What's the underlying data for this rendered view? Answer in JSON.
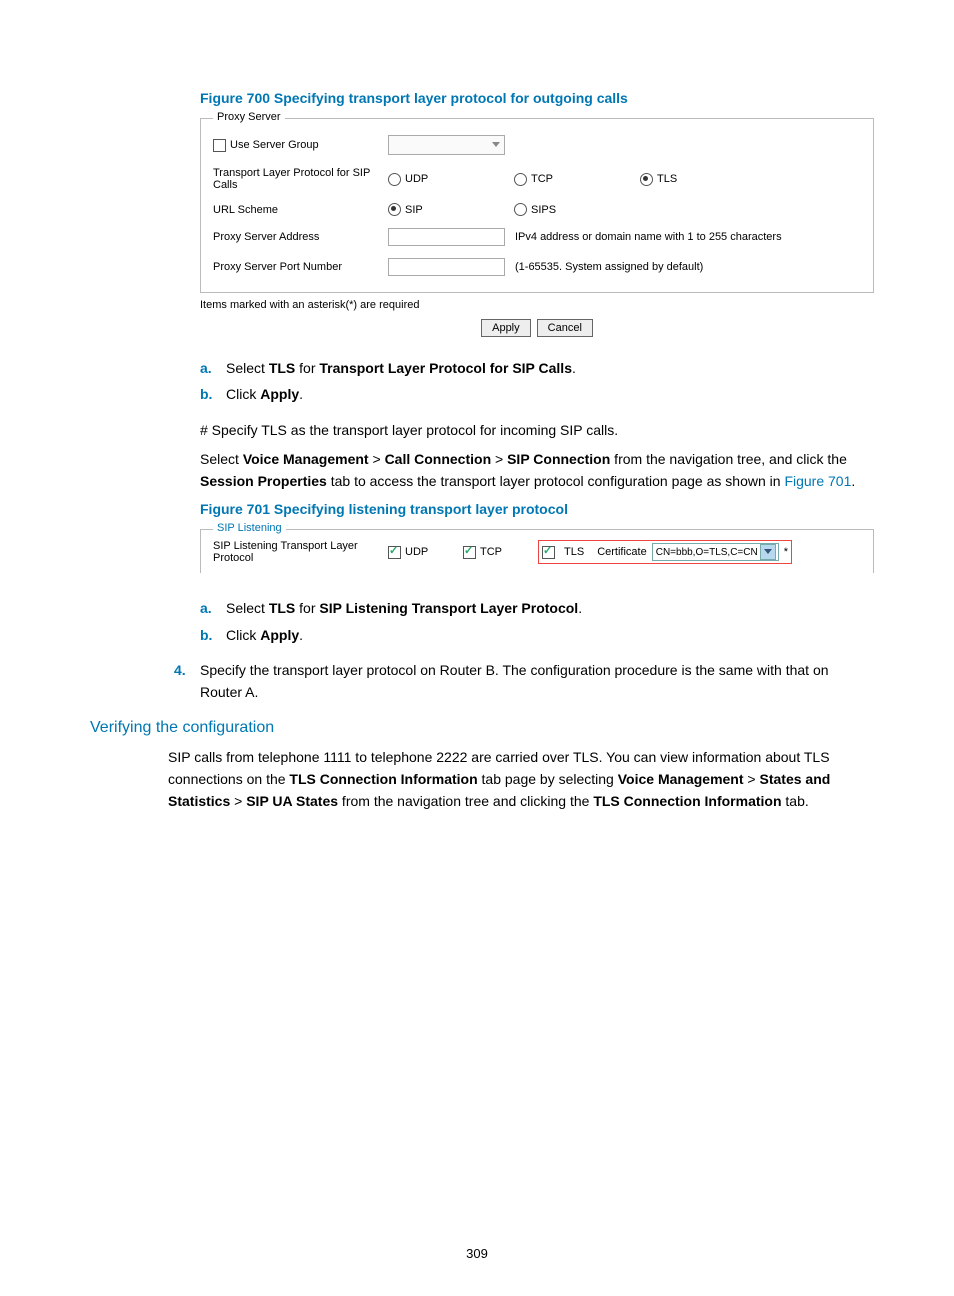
{
  "figure700": {
    "title": "Figure 700 Specifying transport layer protocol for outgoing calls",
    "legend": "Proxy Server",
    "useServerGroup": "Use Server Group",
    "transportLabel": "Transport Layer Protocol for SIP Calls",
    "udp": "UDP",
    "tcp": "TCP",
    "tls": "TLS",
    "urlSchemeLabel": "URL Scheme",
    "sip": "SIP",
    "sips": "SIPS",
    "proxyAddressLabel": "Proxy Server Address",
    "proxyAddressHint": "IPv4 address or domain name with 1 to 255 characters",
    "proxyPortLabel": "Proxy Server Port Number",
    "proxyPortHint": "(1-65535. System assigned by default)",
    "requiredNote": "Items marked with an asterisk(*) are required",
    "applyBtn": "Apply",
    "cancelBtn": "Cancel"
  },
  "steps1": {
    "a": {
      "marker": "a.",
      "pre": "Select ",
      "tls": "TLS",
      "mid": " for ",
      "field": "Transport Layer Protocol for SIP Calls",
      "post": "."
    },
    "b": {
      "marker": "b.",
      "pre": "Click ",
      "apply": "Apply",
      "post": "."
    }
  },
  "para1": "# Specify TLS as the transport layer protocol for incoming SIP calls.",
  "para2": {
    "t1": "Select ",
    "vm": "Voice Management",
    "gt1": " > ",
    "cc": "Call Connection",
    "gt2": " > ",
    "sc": "SIP Connection",
    "t2": " from the navigation tree, and click the ",
    "sp": "Session Properties",
    "t3": " tab to access the transport layer protocol configuration page as shown in ",
    "link": "Figure 701",
    "t4": "."
  },
  "figure701": {
    "title": "Figure 701 Specifying listening transport layer protocol",
    "legend": "SIP Listening",
    "label": "SIP Listening Transport Layer Protocol",
    "udp": "UDP",
    "tcp": "TCP",
    "tls": "TLS",
    "certLabel": "Certificate",
    "certValue": "CN=bbb,O=TLS,C=CN",
    "star": "*"
  },
  "steps2": {
    "a": {
      "marker": "a.",
      "pre": "Select ",
      "tls": "TLS",
      "mid": " for ",
      "field": "SIP Listening Transport Layer Protocol",
      "post": "."
    },
    "b": {
      "marker": "b.",
      "pre": "Click ",
      "apply": "Apply",
      "post": "."
    }
  },
  "step4": {
    "marker": "4.",
    "text": "Specify the transport layer protocol on Router B. The configuration procedure is the same with that on Router A."
  },
  "verifyHeading": "Verifying the configuration",
  "verifyPara": {
    "t1": "SIP calls from telephone 1111 to telephone 2222 are carried over TLS. You can view information about TLS connections on the ",
    "tci": "TLS Connection Information",
    "t2": " tab page by selecting ",
    "vm": "Voice Management",
    "gt1": " > ",
    "ss": "States and Statistics",
    "gt2": " > ",
    "sus": "SIP UA States",
    "t3": " from the navigation tree and clicking the ",
    "tci2": "TLS Connection Information",
    "t4": " tab."
  },
  "pageNumber": "309"
}
